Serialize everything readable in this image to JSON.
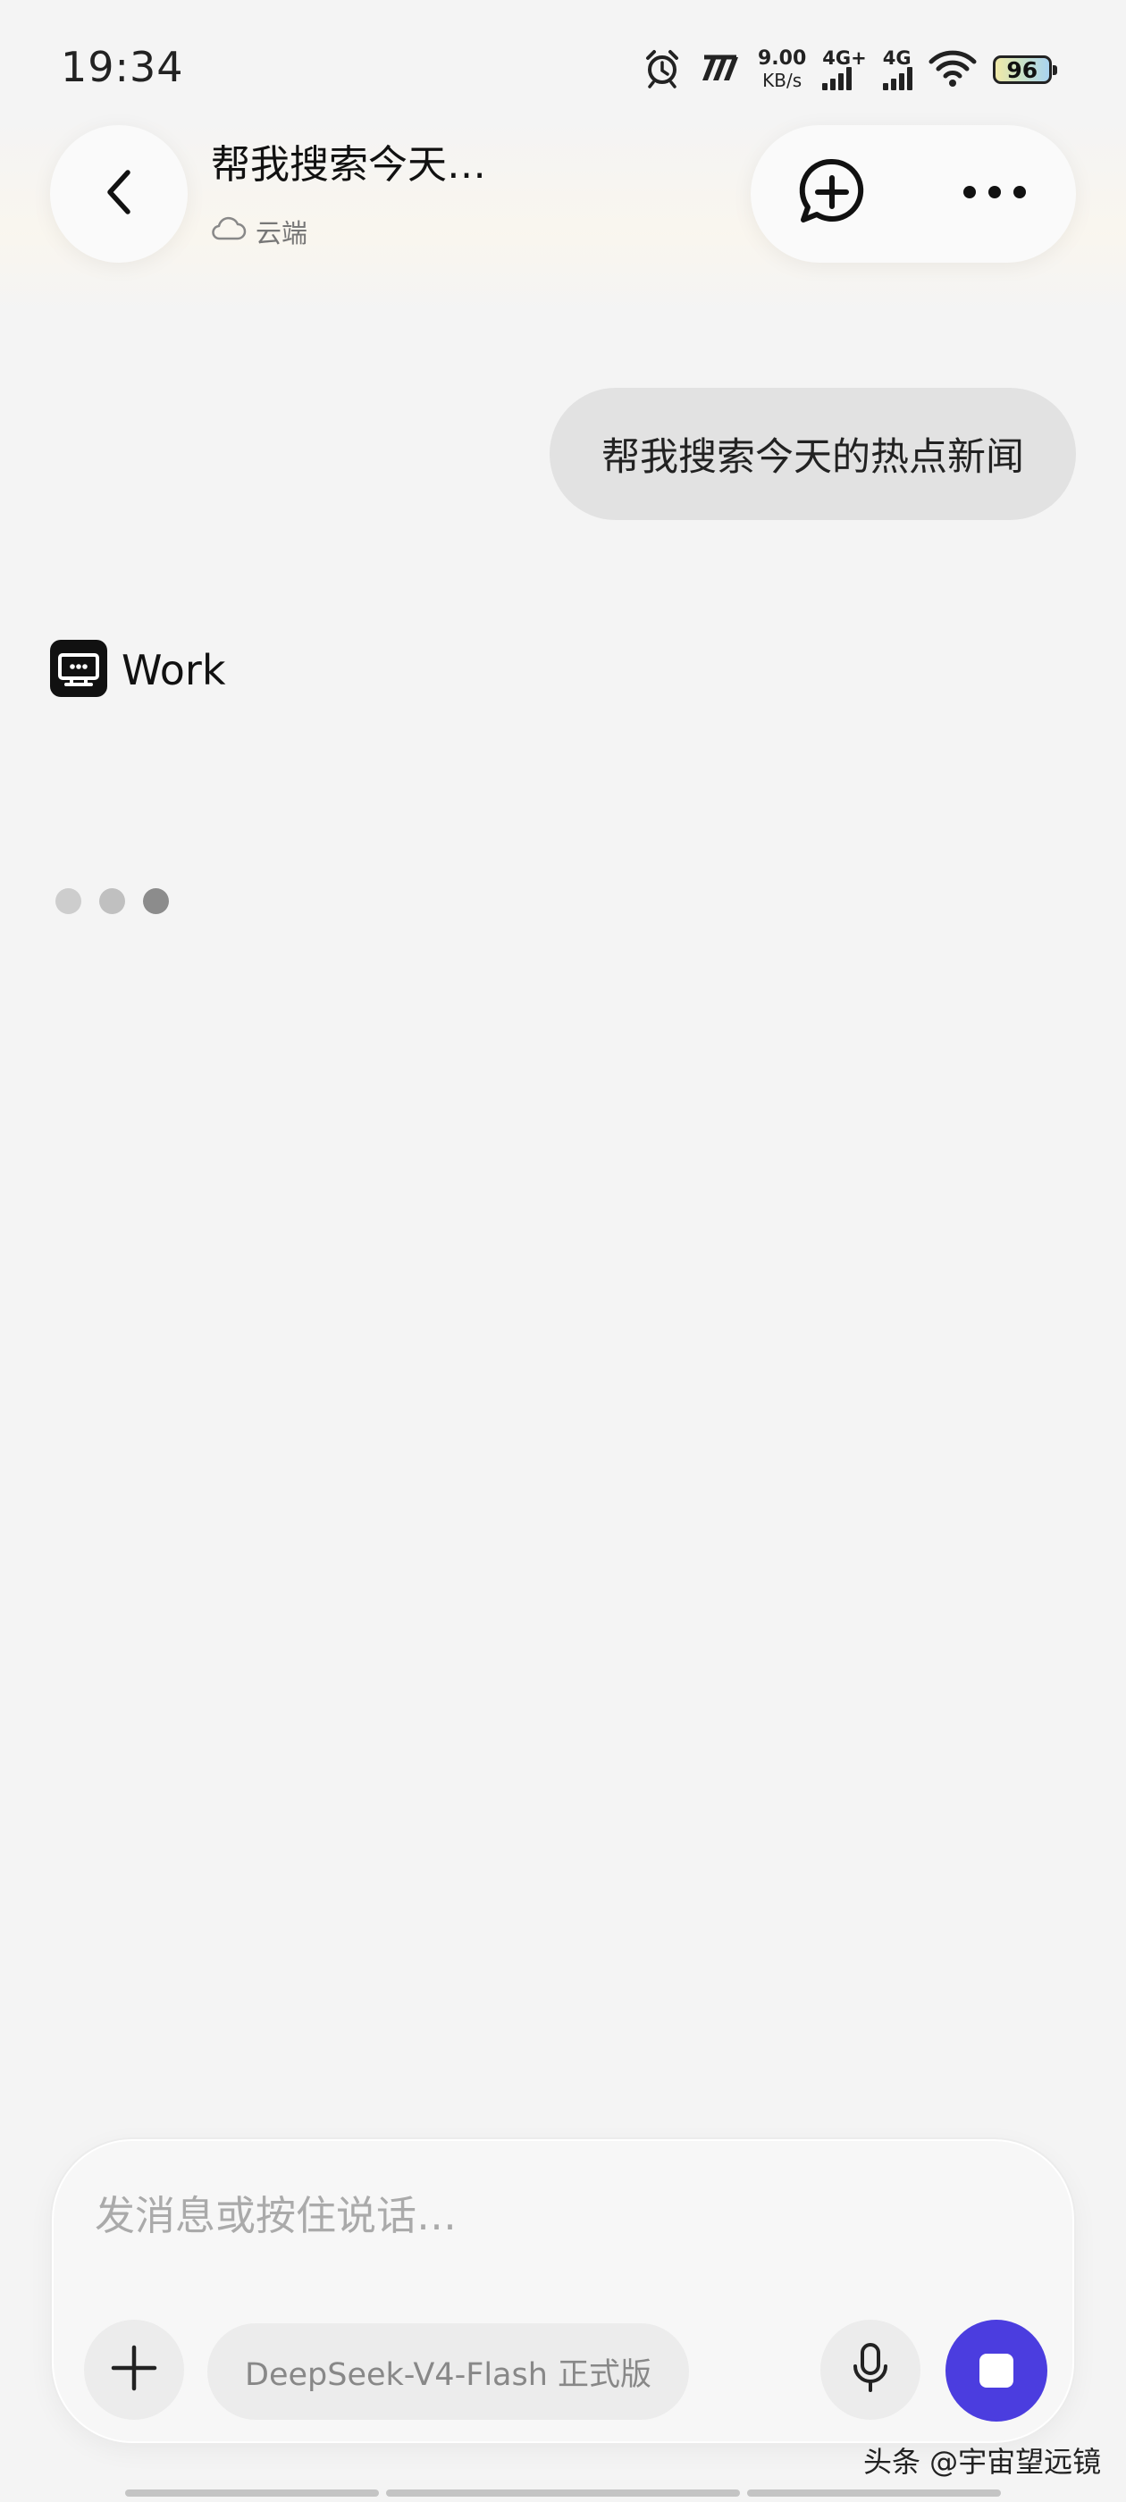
{
  "status_bar": {
    "time": "19:34",
    "net_speed_value": "9.00",
    "net_speed_unit": "KB/s",
    "sim1_label": "4G+",
    "sim2_label": "4G",
    "battery": "96"
  },
  "header": {
    "title": "帮我搜索今天…",
    "storage_label": "云端"
  },
  "conversation": {
    "user_message": "帮我搜索今天的热点新闻",
    "agent_name": "Work",
    "agent_state": "typing"
  },
  "composer": {
    "placeholder": "发消息或按住说话…",
    "model_label": "DeepSeek-V4-Flash 正式版"
  },
  "watermark": "头条 @宇宙望远镜",
  "colors": {
    "accent": "#4b3ddf",
    "background": "#f4f4f4",
    "user_bubble": "#e2e2e2"
  },
  "icons": [
    "alarm-icon",
    "signal-icon",
    "wifi-icon",
    "battery-icon",
    "back-icon",
    "cloud-icon",
    "new-chat-icon",
    "more-icon",
    "work-agent-icon",
    "add-icon",
    "mic-icon",
    "stop-icon"
  ]
}
